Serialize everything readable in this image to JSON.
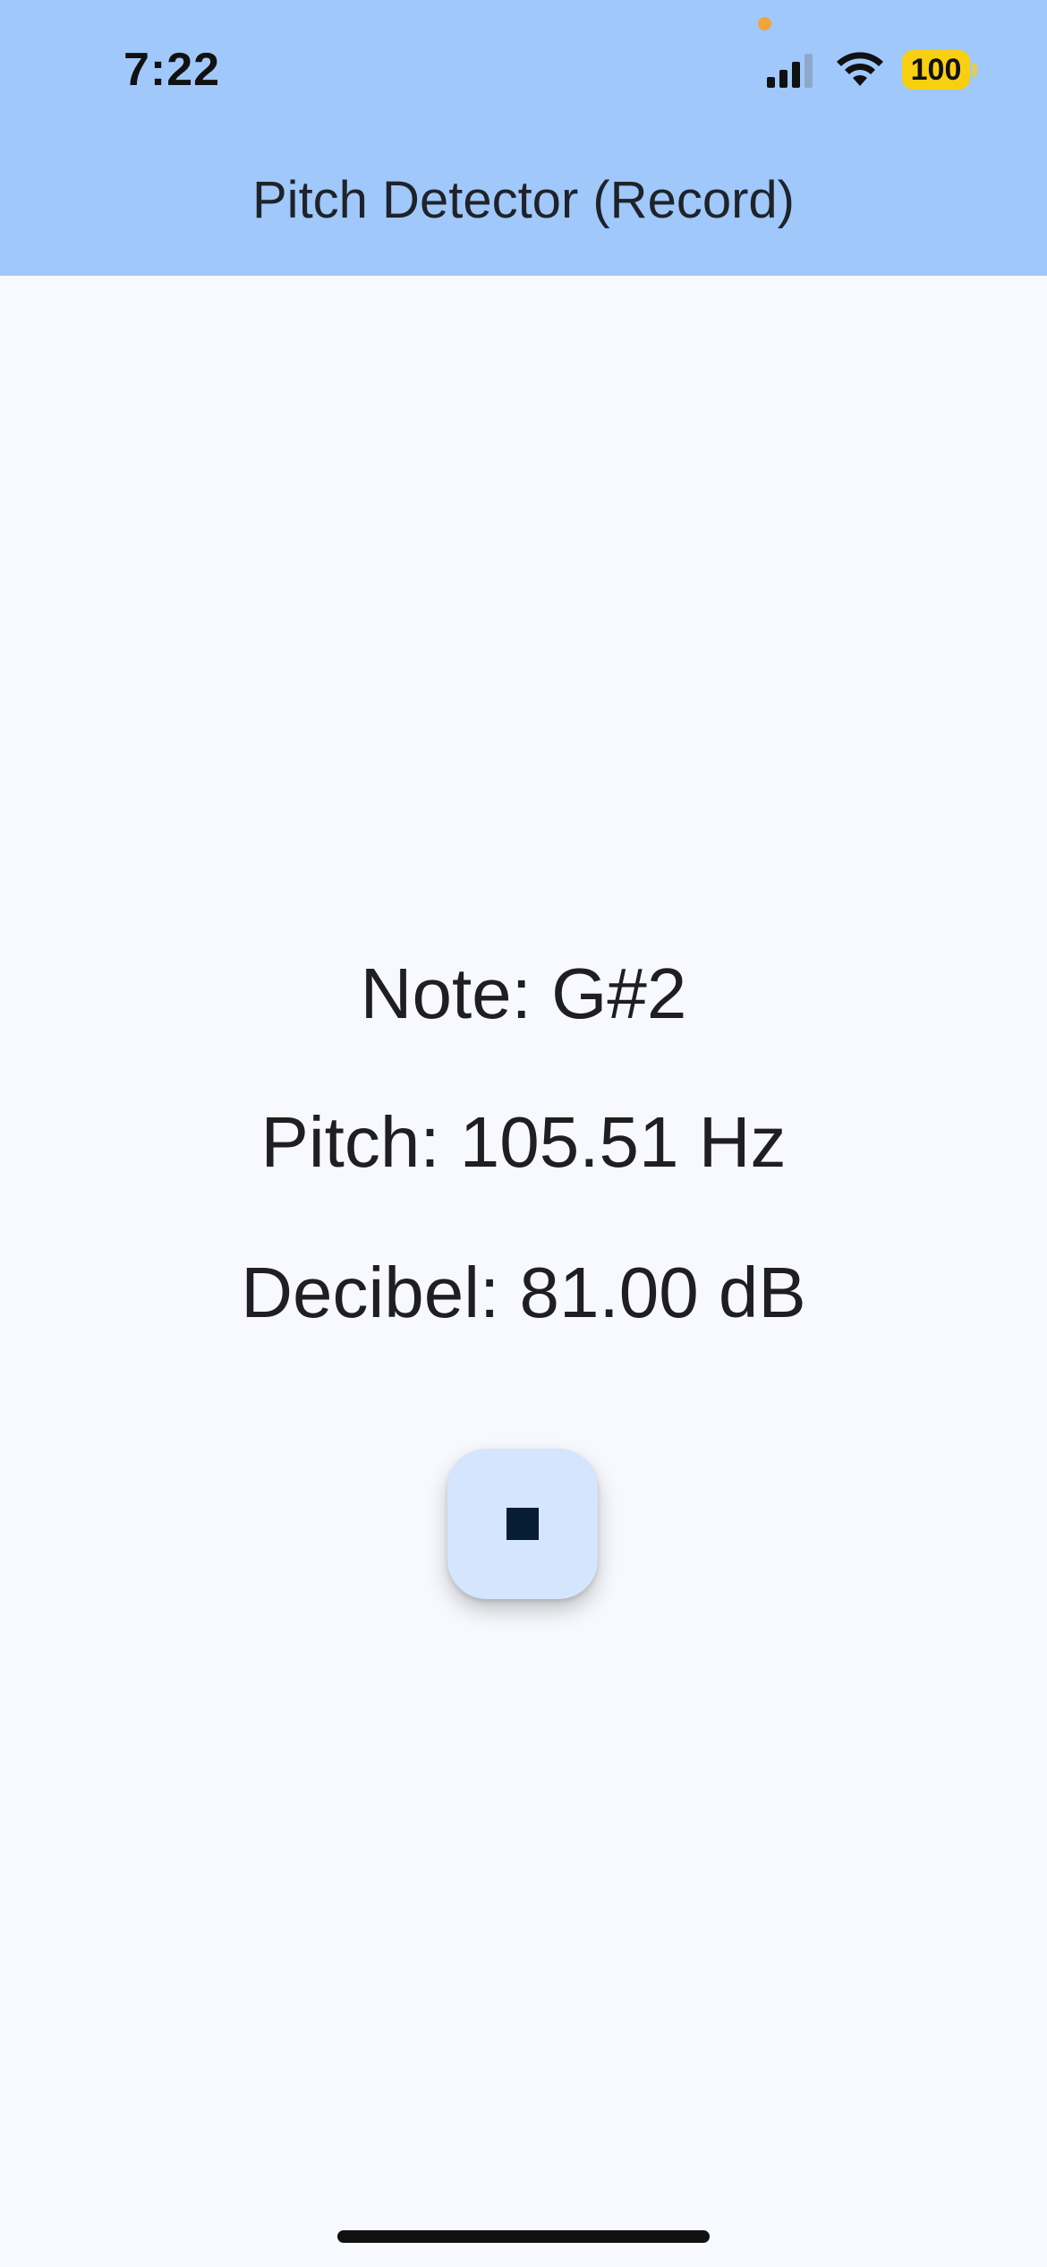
{
  "status_bar": {
    "time": "7:22",
    "battery_level": "100",
    "battery_color": "#f9cf11",
    "mic_indicator_color": "#f2a33a",
    "icons": [
      "signal-icon",
      "wifi-icon",
      "battery-icon"
    ]
  },
  "header": {
    "title": "Pitch Detector (Record)",
    "background": "#a0c8fb"
  },
  "readouts": {
    "note": "Note: G#2",
    "pitch": "Pitch: 105.51 Hz",
    "decibel": "Decibel: 81.00 dB"
  },
  "controls": {
    "stop_button_icon": "stop-icon",
    "stop_button_background": "#d5e5fd"
  }
}
